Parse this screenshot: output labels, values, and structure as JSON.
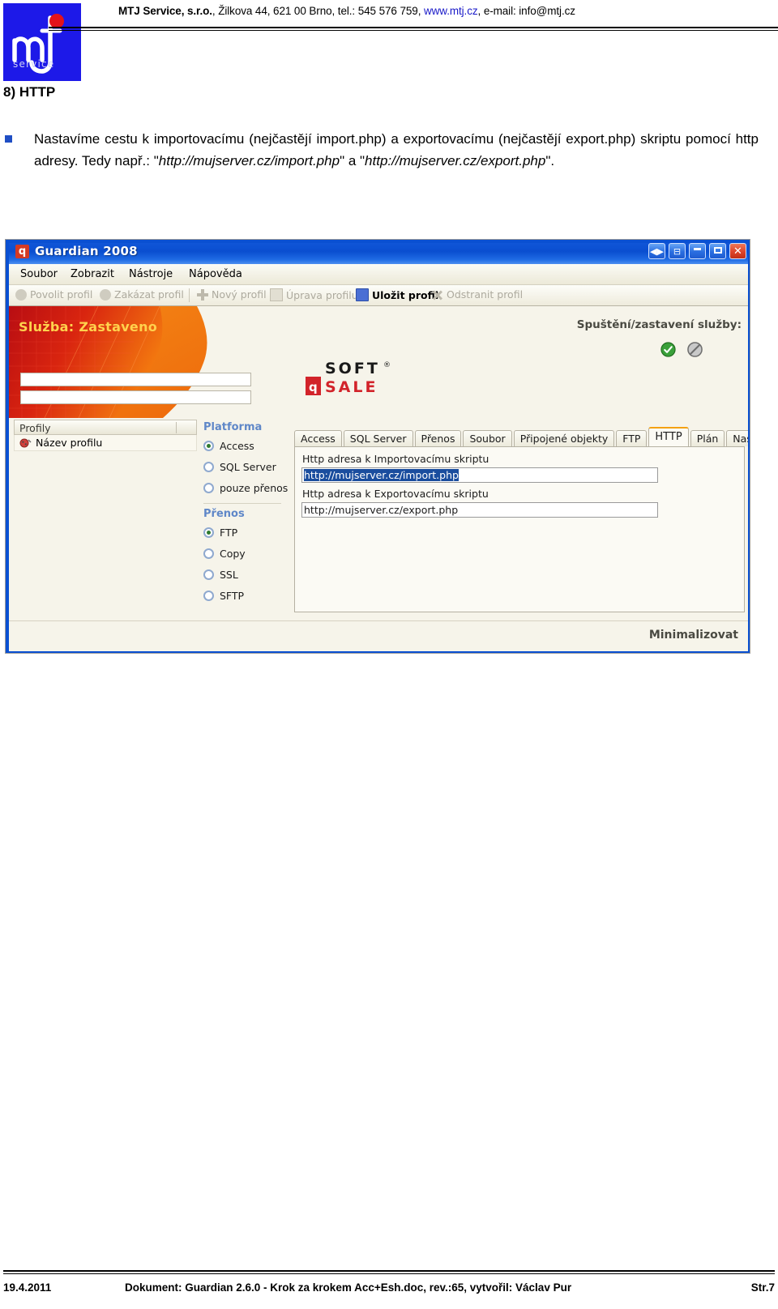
{
  "header": {
    "company": "MTJ Service, s.r.o.",
    "address": ", Žilkova 44, 621 00 Brno, tel.: 545 576 759, ",
    "web": "www.mtj.cz",
    "email_prefix": ", e-mail: ",
    "email": "info@mtj.cz",
    "logo_text": "mtj",
    "logo_sub": "service"
  },
  "section": {
    "title": "8) HTTP",
    "bullet": {
      "part1": "Nastavíme cestu k importovacímu (nejčastějí import.php) a exportovacímu (nejčastějí export.php) skriptu pomocí http adresy. Tedy např.: \"",
      "italic1": "http://mujserver.cz/import.php",
      "part2": "\" a \"",
      "italic2": "http://mujserver.cz/export.php",
      "part3": "\"."
    }
  },
  "app": {
    "title": "Guardian 2008",
    "title_icon": "q",
    "titlebar_buttons": [
      {
        "name": "collapse-expand-button",
        "glyph": "◀▶"
      },
      {
        "name": "panel-toggle-button",
        "glyph": "⊟"
      },
      {
        "name": "minimize-button",
        "glyph": ""
      },
      {
        "name": "maximize-button",
        "glyph": ""
      },
      {
        "name": "close-button",
        "glyph": "✕"
      }
    ],
    "menu": [
      "Soubor",
      "Zobrazit",
      "Nástroje",
      "Nápověda"
    ],
    "toolbar": [
      {
        "label": "Povolit profil",
        "enabled": false,
        "icon": "play-icon"
      },
      {
        "label": "Zakázat profil",
        "enabled": false,
        "icon": "block-icon"
      },
      {
        "label": "Nový profil",
        "enabled": false,
        "icon": "plus-icon"
      },
      {
        "label": "Úprava profilu",
        "enabled": false,
        "icon": "edit-document-icon"
      },
      {
        "label": "Uložit profil",
        "enabled": true,
        "icon": "save-disk-icon"
      },
      {
        "label": "Odstranit profil",
        "enabled": false,
        "icon": "delete-x-icon"
      }
    ],
    "banner": {
      "status": "Služba: Zastaveno",
      "service_label": "Spuštění/zastavení služby:",
      "start_button": "start-service-icon",
      "stop_button": "stop-service-icon",
      "brand_line1": "SOFT",
      "brand_line2": "SALE",
      "brand_mark": "®"
    },
    "profiles": {
      "header": "Profily",
      "items": [
        {
          "label": "Název profilu"
        }
      ]
    },
    "platform_group": {
      "title": "Platforma",
      "options": [
        {
          "label": "Access",
          "selected": true
        },
        {
          "label": "SQL Server",
          "selected": false
        },
        {
          "label": "pouze přenos",
          "selected": false
        }
      ]
    },
    "transfer_group": {
      "title": "Přenos",
      "options": [
        {
          "label": "FTP",
          "selected": true
        },
        {
          "label": "Copy",
          "selected": false
        },
        {
          "label": "SSL",
          "selected": false
        },
        {
          "label": "SFTP",
          "selected": false
        }
      ]
    },
    "tabs": [
      {
        "label": "Access",
        "active": false
      },
      {
        "label": "SQL Server",
        "active": false
      },
      {
        "label": "Přenos",
        "active": false
      },
      {
        "label": "Soubor",
        "active": false
      },
      {
        "label": "Připojené objekty",
        "active": false
      },
      {
        "label": "FTP",
        "active": false
      },
      {
        "label": "HTTP",
        "active": true
      },
      {
        "label": "Plán",
        "active": false
      },
      {
        "label": "Nastavení",
        "active": false
      }
    ],
    "http_tab": {
      "import_label": "Http adresa k Importovacímu skriptu",
      "import_value": "http://mujserver.cz/import.php",
      "export_label": "Http adresa k Exportovacímu skriptu",
      "export_value": "http://mujserver.cz/export.php"
    },
    "minimize_label": "Minimalizovat"
  },
  "footer": {
    "date": "19.4.2011",
    "document": "Dokument: Guardian 2.6.0 - Krok za krokem Acc+Esh.doc, rev.:65, vytvořil: Václav Pur",
    "page": "Str.7"
  },
  "colors": {
    "logo_blue": "#1d19e8",
    "link_blue": "#1919c8",
    "bullet_blue": "#1f4ec4",
    "title_bar_blue": "#0a4ed0",
    "banner_orange": "#f07a14",
    "banner_red": "#c4101a",
    "tab_accent": "#f4a213",
    "group_head_blue": "#5f87c8",
    "selection_blue": "#1a4d9e"
  }
}
